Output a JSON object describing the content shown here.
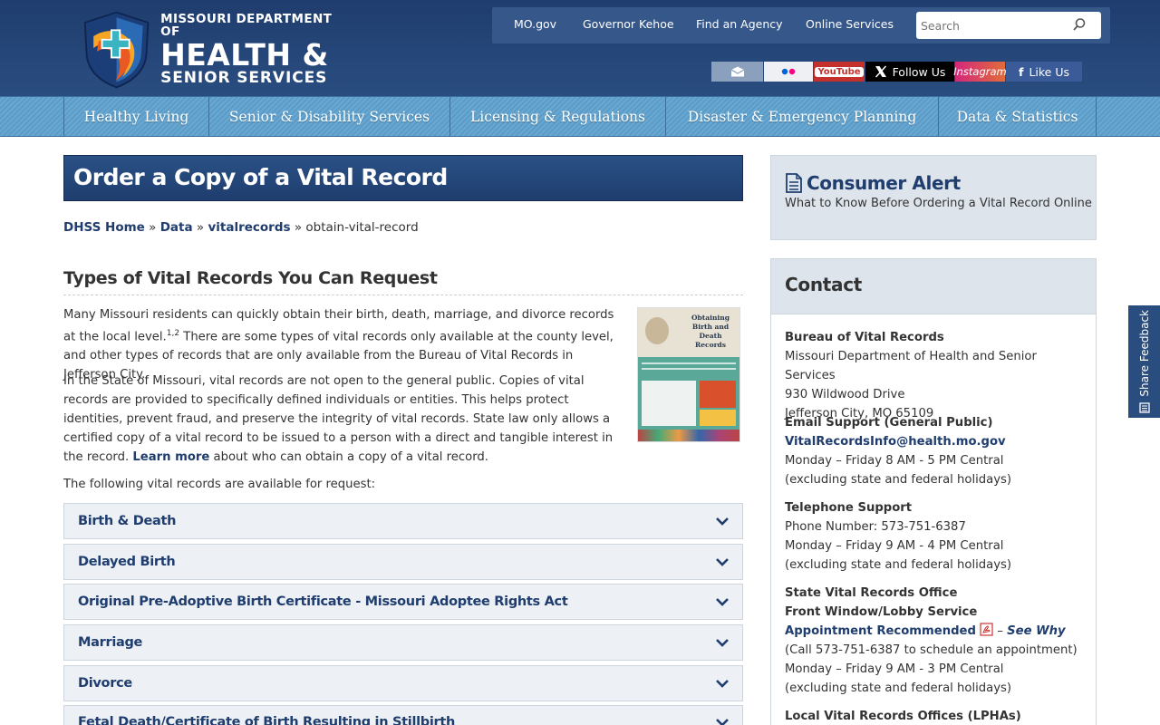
{
  "header": {
    "logo": {
      "line1": "MISSOURI DEPARTMENT OF",
      "line2": "HEALTH &",
      "line3": "SENIOR SERVICES"
    },
    "utility_links": [
      "MO.gov",
      "Governor Kehoe",
      "Find an Agency",
      "Online Services"
    ],
    "search_placeholder": "Search",
    "social": {
      "youtube": "YouTube",
      "x": "Follow Us",
      "instagram": "Instagram",
      "facebook": "Like Us"
    }
  },
  "nav": [
    "Healthy Living",
    "Senior & Disability Services",
    "Licensing & Regulations",
    "Disaster & Emergency Planning",
    "Data & Statistics"
  ],
  "main": {
    "title": "Order a Copy of a Vital Record",
    "breadcrumb": {
      "home": "DHSS Home",
      "sep": "»",
      "data": "Data",
      "vital": "vitalrecords",
      "current": "obtain-vital-record"
    },
    "section_title": "Types of Vital Records You Can Request",
    "p1_a": "Many Missouri residents can quickly obtain their birth, death, marriage, and divorce records at the local level.",
    "p1_sup": "1,2",
    "p1_b": " There are some types of vital records only available at the county level, and other types of records that are only available from the Bureau of Vital Records in Jefferson City.",
    "p2_a": "In the State of Missouri, vital records are not open to the general public. Copies of vital records are provided to specifically defined individuals or entities. This helps protect identities, prevent fraud, and preserve the integrity of vital records. State law only allows a certified copy of a vital record to be issued to a person with a direct and tangible interest in the record. ",
    "p2_link": "Learn more",
    "p2_b": " about who can obtain a copy of a vital record.",
    "p3": "The following vital records are available for request:",
    "poster": {
      "title_line1": "Obtaining",
      "title_line2": "Birth and",
      "title_line3": "Death Records"
    },
    "accordion": [
      "Birth & Death",
      "Delayed Birth",
      "Original Pre-Adoptive Birth Certificate - Missouri Adoptee Rights Act",
      "Marriage",
      "Divorce",
      "Fetal Death/Certificate of Birth Resulting in Stillbirth"
    ]
  },
  "sidebar": {
    "alert_title": "Consumer Alert",
    "alert_sub": "What to Know Before Ordering a Vital Record Online",
    "contact_title": "Contact",
    "bureau": {
      "name": "Bureau of Vital Records",
      "line1": "Missouri Department of Health and Senior Services",
      "line2": "930 Wildwood Drive",
      "line3": "Jefferson City, MO 65109"
    },
    "email": {
      "heading": "Email Support (General Public)",
      "address": "VitalRecordsInfo@health.mo.gov",
      "hours": "Monday – Friday 8 AM - 5 PM Central",
      "note": "(excluding state and federal holidays)"
    },
    "phone": {
      "heading": "Telephone Support",
      "number": "Phone Number: 573-751-6387",
      "hours": "Monday – Friday 9 AM - 4 PM Central",
      "note": "(excluding state and federal holidays)"
    },
    "office": {
      "heading": "State Vital Records Office Front Window/Lobby Service",
      "appt": "Appointment Recommended",
      "dash": " – ",
      "why": "See Why",
      "call": "(Call 573-751-6387 to schedule an appointment)",
      "hours": "Monday – Friday 9 AM - 3 PM Central",
      "note": "(excluding state and federal holidays)"
    },
    "local": "Local Vital Records Offices (LPHAs)"
  },
  "feedback": "Share Feedback",
  "colors": {
    "brand_navy": "#1f3d6e",
    "nav_blue": "#5a9bc7",
    "panel_gray": "#dde4ec"
  }
}
